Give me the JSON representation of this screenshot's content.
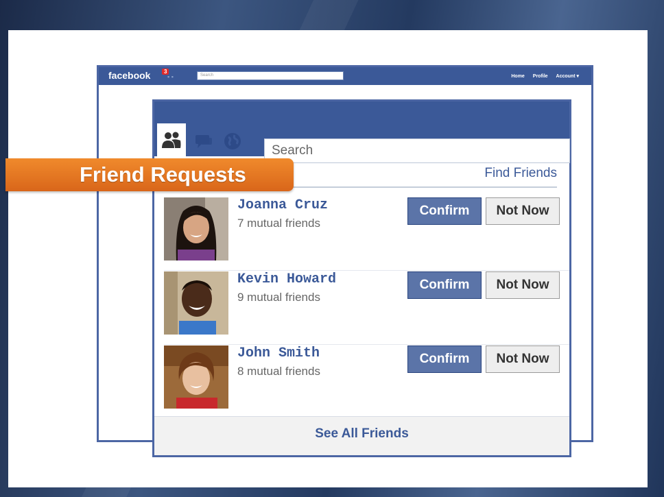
{
  "back_window": {
    "logo": "facebook",
    "notification_count": "3",
    "search_placeholder": "Search",
    "nav": [
      "Home",
      "Profile",
      "Account ▾"
    ]
  },
  "callout": {
    "label": "Friend Requests"
  },
  "panel": {
    "search_placeholder": "Search",
    "find_friends_link": "Find Friends",
    "tabs": [
      "friend-requests-icon",
      "messages-icon",
      "notifications-globe-icon"
    ],
    "requests": [
      {
        "name": "Joanna Cruz",
        "mutual": "7 mutual friends",
        "confirm": "Confirm",
        "not_now": "Not Now"
      },
      {
        "name": "Kevin Howard",
        "mutual": "9 mutual friends",
        "confirm": "Confirm",
        "not_now": "Not Now"
      },
      {
        "name": "John Smith",
        "mutual": "8 mutual friends",
        "confirm": "Confirm",
        "not_now": "Not Now"
      }
    ],
    "see_all": "See All Friends"
  },
  "colors": {
    "facebook_blue": "#3b5998",
    "confirm_button": "#5b74a8",
    "callout_orange": "#e8771f"
  }
}
